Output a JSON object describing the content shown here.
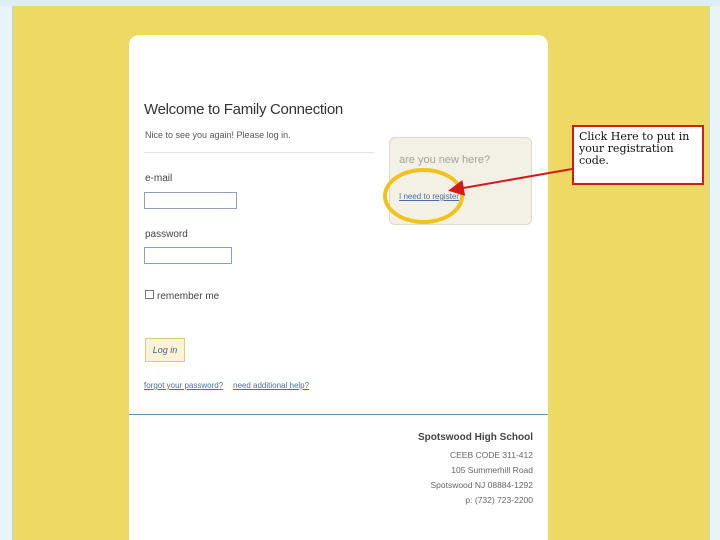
{
  "login": {
    "title": "Welcome to Family Connection",
    "subtitle": "Nice to see you again! Please log in.",
    "email_label": "e-mail",
    "email_value": "",
    "password_label": "password",
    "password_value": "",
    "remember_label": "remember me",
    "remember_checked": false,
    "login_button": "Log in",
    "forgot_link": "forgot your password?",
    "help_link": "need additional help?"
  },
  "new_user": {
    "title": "are you new here?",
    "register_link": "I need to register"
  },
  "school": {
    "name": "Spotswood High School",
    "ceeb": "CEEB CODE 311-412",
    "street": "105 Summerhill Road",
    "city": "Spotswood NJ 08884-1292",
    "phone": "p: (732) 723-2200"
  },
  "annotation": {
    "callout_text": "Click Here to put in your registration code.",
    "highlight_color": "#f0c21c",
    "arrow_color": "#d11c1c"
  },
  "colors": {
    "background": "#eed964",
    "link": "#4a6ea5",
    "button_bg": "#fbf3d6"
  }
}
